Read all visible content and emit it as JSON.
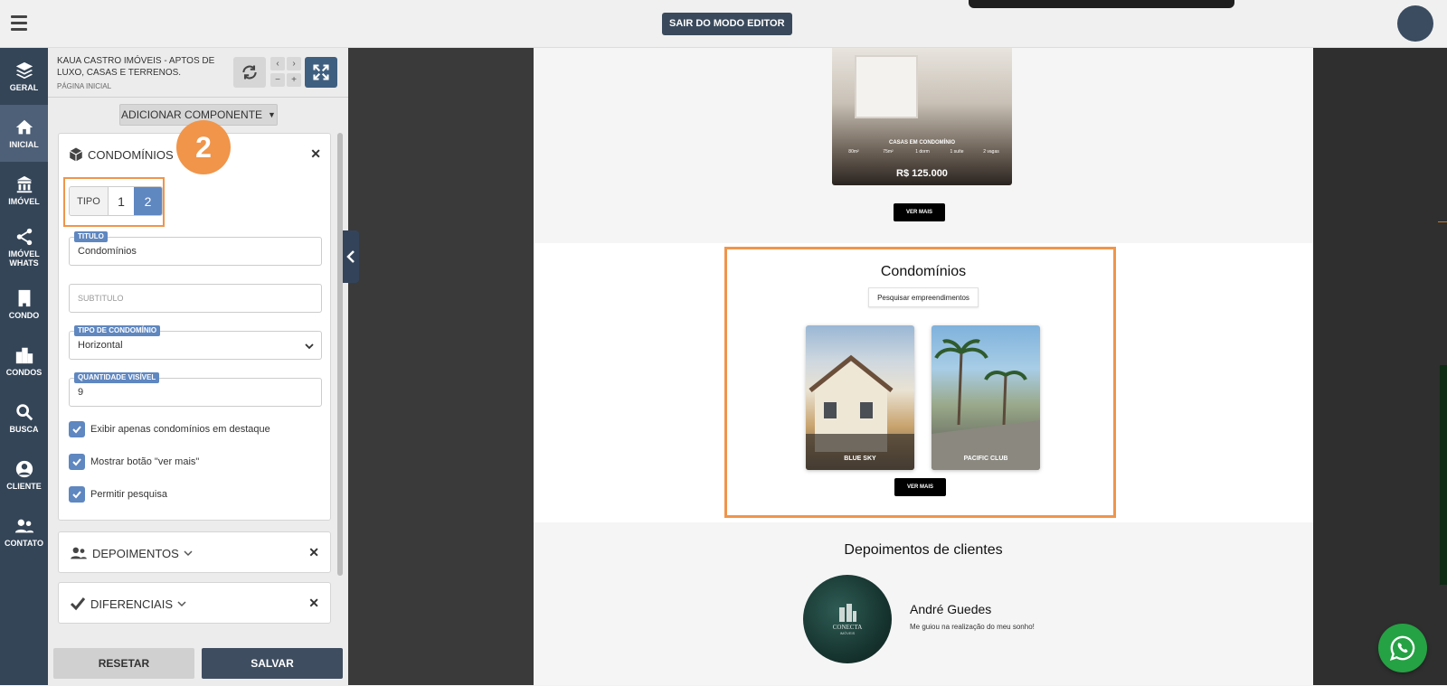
{
  "topbar": {
    "exit_label": "SAIR DO MODO EDITOR"
  },
  "sidenav": {
    "items": [
      {
        "label": "GERAL",
        "icon": "layers-icon"
      },
      {
        "label": "INICIAL",
        "icon": "home-icon"
      },
      {
        "label": "IMÓVEL",
        "icon": "building-icon"
      },
      {
        "label": "IMÓVEL WHATS",
        "icon": "share-icon"
      },
      {
        "label": "CONDO",
        "icon": "tower-icon"
      },
      {
        "label": "CONDOS",
        "icon": "city-icon"
      },
      {
        "label": "BUSCA",
        "icon": "search-icon"
      },
      {
        "label": "CLIENTE",
        "icon": "user-icon"
      },
      {
        "label": "CONTATO",
        "icon": "users-icon"
      }
    ]
  },
  "panel": {
    "site_title": "KAUA CASTRO IMÓVEIS - APTOS DE LUXO, CASAS E TERRENOS.",
    "page_label": "PÁGINA INICIAL",
    "add_component": "ADICIONAR COMPONENTE",
    "condo_card": {
      "title": "CONDOMÍNIOS",
      "badge": "2",
      "tipo_label": "TIPO",
      "tipo_options": [
        "1",
        "2"
      ],
      "tipo_selected": "2",
      "titulo_label": "TITULO",
      "titulo_value": "Condomínios",
      "subtitulo_placeholder": "SUBTITULO",
      "tipo_condominio_label": "TIPO DE CONDOMÍNIO",
      "tipo_condominio_value": "Horizontal",
      "quantidade_label": "QUANTIDADE VISÍVEL",
      "quantidade_value": "9",
      "checkboxes": [
        {
          "label": "Exibir apenas condomínios em destaque",
          "checked": true
        },
        {
          "label": "Mostrar botão \"ver mais\"",
          "checked": true
        },
        {
          "label": "Permitir pesquisa",
          "checked": true
        }
      ]
    },
    "sections": [
      {
        "title": "DEPOIMENTOS",
        "icon": "users-icon"
      },
      {
        "title": "DIFERENCIAIS",
        "icon": "check-icon"
      }
    ],
    "reset_label": "RESETAR",
    "save_label": "SALVAR"
  },
  "preview": {
    "property": {
      "category": "CASAS EM CONDOMÍNIO",
      "specs": [
        "80m²",
        "75m²",
        "1 dorm",
        "1 suíte",
        "2 vagas"
      ],
      "price": "R$ 125.000",
      "ver_mais": "VER MAIS"
    },
    "condos": {
      "title": "Condomínios",
      "search_label": "Pesquisar empreendimentos",
      "items": [
        {
          "name": "BLUE SKY"
        },
        {
          "name": "PACIFIC CLUB"
        }
      ],
      "ver_mais": "VER MAIS"
    },
    "testimonials": {
      "title": "Depoimentos de clientes",
      "logo_text": "CONECTA",
      "logo_sub": "IMÓVEIS",
      "name": "André Guedes",
      "text": "Me guiou na realização do meu sonho!"
    }
  },
  "colors": {
    "accent": "#5f87c0",
    "highlight": "#f0954a",
    "nav_bg": "#344558",
    "whatsapp": "#25a244"
  }
}
